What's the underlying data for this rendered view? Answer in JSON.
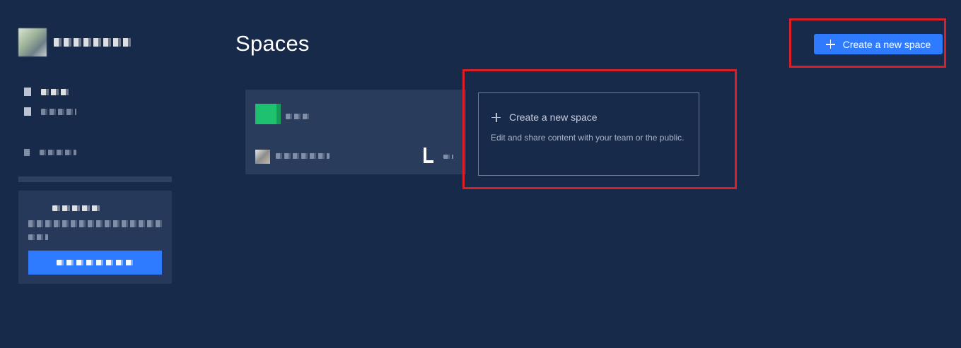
{
  "sidebar": {
    "user_icon": "avatar-icon",
    "nav_icons": [
      "document-icon",
      "people-icon",
      "settings-icon"
    ]
  },
  "main": {
    "title": "Spaces",
    "create_button_label": "Create a new space",
    "new_space_card": {
      "title": "Create a new space",
      "description": "Edit and share content with your team or the public."
    }
  },
  "colors": {
    "background": "#182a4a",
    "accent": "#2f7bff",
    "highlight": "#dc1f26",
    "space_logo": "#1ec26e"
  }
}
